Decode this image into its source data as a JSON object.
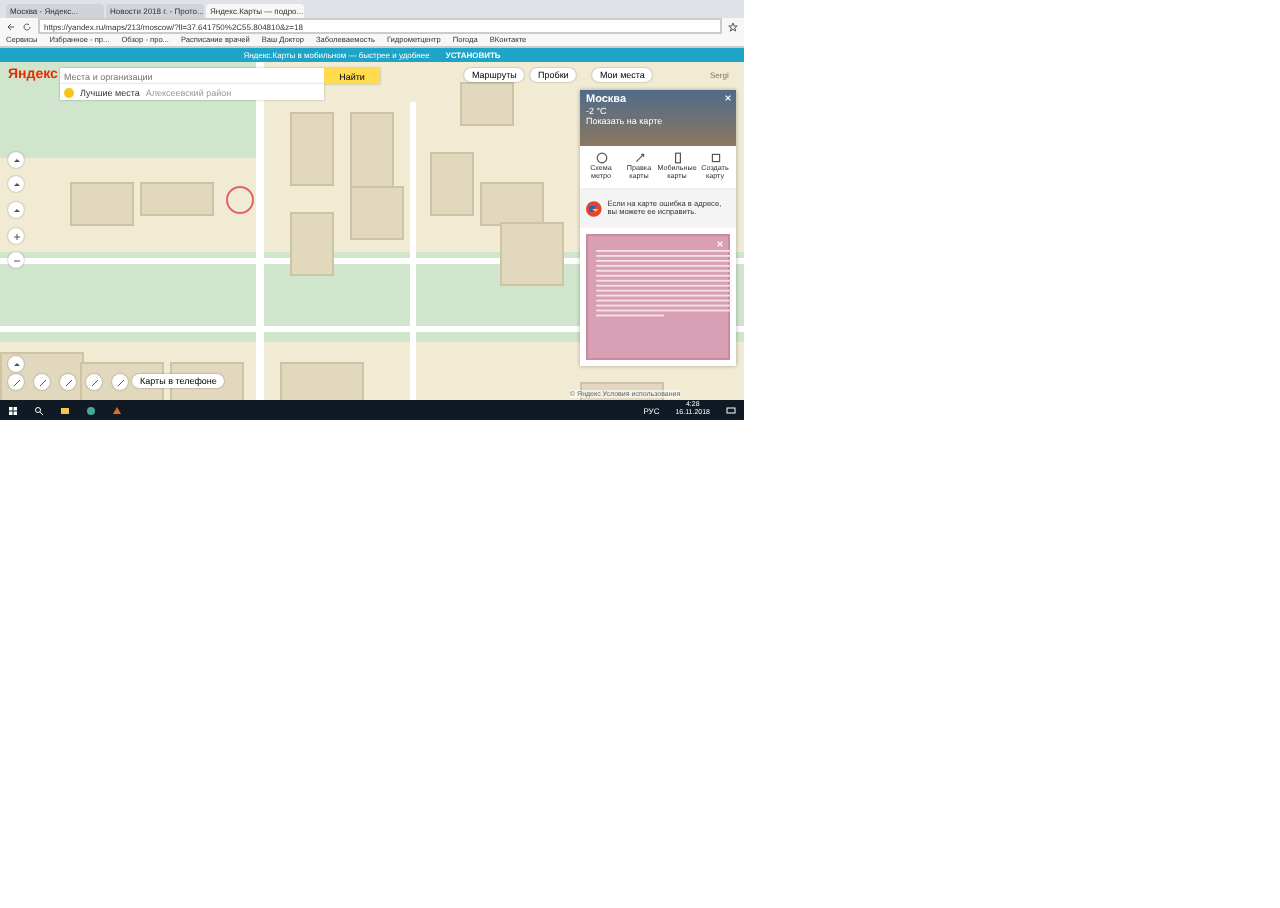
{
  "browser": {
    "tabs": [
      {
        "title": "Москва - Яндекс...",
        "selected": false
      },
      {
        "title": "Новости 2018 г. - Прото...",
        "selected": false
      },
      {
        "title": "Яндекс.Карты — подро...",
        "selected": true
      }
    ],
    "address": "https://yandex.ru/maps/213/moscow/?ll=37.641750%2C55.804810&z=18",
    "bookmarks": [
      "Сервисы",
      "Избранное - пр...",
      "Обзор - про...",
      "Расписание врачей",
      "Ваш Доктор",
      "Заболеваемость",
      "Гидрометцентр",
      "Погода",
      "ВКонтакте"
    ]
  },
  "banner": {
    "text": "Яндекс.Карты в мобильном — быстрее и удобнее",
    "button": "УСТАНОВИТЬ"
  },
  "map": {
    "logo": "Яндекс",
    "search": {
      "placeholder": "Места и организации",
      "button": "Найти"
    },
    "suggestion": {
      "title": "Лучшие места",
      "subtitle": "Алексеевский район"
    },
    "top_buttons": [
      "Маршруты",
      "Пробки",
      "Мои места"
    ],
    "user": "Sergi",
    "phone_promo": "Карты в телефоне",
    "copyright": "© Яндекс Условия использования"
  },
  "panel": {
    "city": "Москва",
    "weather": "-2 °C",
    "subtitle": "Показать на карте",
    "actions": [
      "Схема метро",
      "Правка карты",
      "Мобильные карты",
      "Создать карту"
    ],
    "notice": "Если на карте ошибка в адресе, вы можете ее исправить."
  },
  "taskbar": {
    "language": "РУС",
    "time": "4:28",
    "date": "16.11.2018"
  }
}
